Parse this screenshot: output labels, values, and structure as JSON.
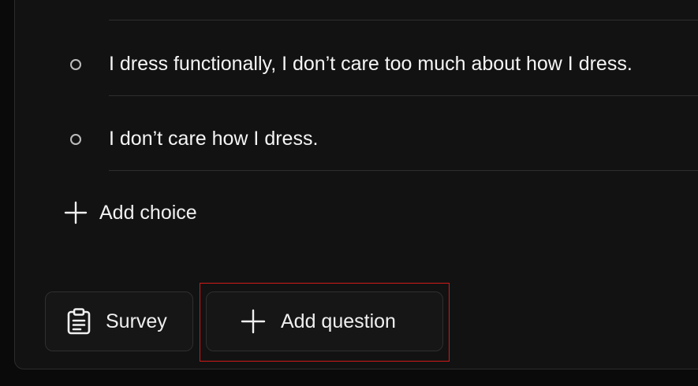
{
  "choices": [
    {
      "label": "I dress functionally, I don’t care too much about how I dress."
    },
    {
      "label": "I don’t care how I dress."
    }
  ],
  "add_choice": {
    "label": "Add choice",
    "icon": "plus-icon"
  },
  "footer": {
    "survey_button": {
      "label": "Survey",
      "icon": "clipboard-icon"
    },
    "add_question_button": {
      "label": "Add question",
      "icon": "plus-icon"
    }
  },
  "colors": {
    "background": "#0a0a0a",
    "panel": "#121212",
    "highlight": "#d11a1a",
    "text": "#f2f2f2"
  }
}
